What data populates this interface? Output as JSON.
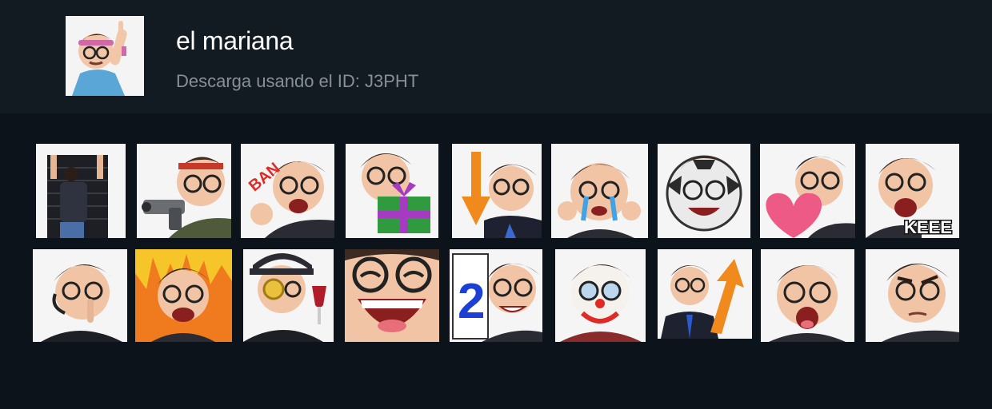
{
  "pack": {
    "title": "el mariana",
    "subtitle": "Descarga usando el ID: J3PHT"
  },
  "avatar": {
    "icon": "cartoon-man-headband-pointing-icon"
  },
  "stickers": [
    {
      "icon": "man-closing-shutter-icon"
    },
    {
      "icon": "man-headband-with-gun-icon"
    },
    {
      "icon": "man-shouting-ban-icon",
      "text": "BAN"
    },
    {
      "icon": "man-with-gift-icon"
    },
    {
      "icon": "man-down-arrow-icon"
    },
    {
      "icon": "man-crying-icon"
    },
    {
      "icon": "man-soccer-ball-face-icon"
    },
    {
      "icon": "man-with-heart-icon"
    },
    {
      "icon": "man-screaming-keee-icon",
      "text": "KEEE"
    },
    {
      "icon": "man-shush-headset-icon"
    },
    {
      "icon": "man-angry-fire-icon"
    },
    {
      "icon": "man-monocle-wine-icon"
    },
    {
      "icon": "man-laughing-closeup-icon"
    },
    {
      "icon": "man-holding-number-two-icon",
      "text": "2"
    },
    {
      "icon": "man-clown-makeup-icon"
    },
    {
      "icon": "man-suit-up-arrow-icon"
    },
    {
      "icon": "man-shocked-face-icon"
    },
    {
      "icon": "man-skeptical-face-icon"
    }
  ],
  "colors": {
    "background": "#0c131a",
    "header": "#121a22",
    "title": "#ffffff",
    "subtitle": "#8a8f95"
  }
}
